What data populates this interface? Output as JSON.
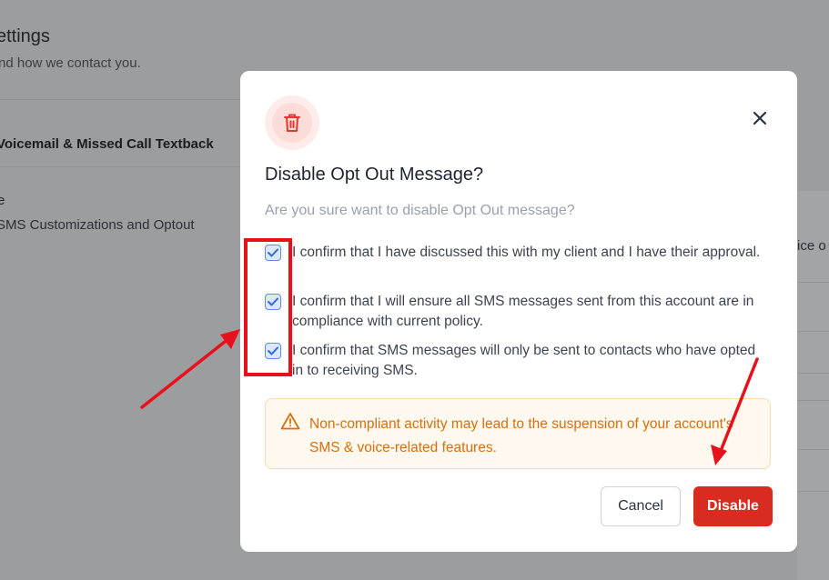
{
  "background": {
    "title": "ettings",
    "subtitle": "nd how we contact you.",
    "section_label": "Voicemail & Missed Call Textback",
    "item_title": "e",
    "item_subtitle": "SMS Customizations and Optout",
    "right_fragment": "ice o"
  },
  "modal": {
    "icon": "trash-icon",
    "title": "Disable Opt Out Message?",
    "description": "Are you sure want to disable Opt Out message?",
    "close_icon": "close-icon",
    "checkboxes": [
      {
        "checked": true,
        "label": "I confirm that I have discussed this with my client and I have their approval."
      },
      {
        "checked": true,
        "label": "I confirm that I will ensure all SMS messages sent from this account are in compliance with current policy."
      },
      {
        "checked": true,
        "label": "I confirm that SMS messages will only be sent to contacts who have opted in to receiving SMS."
      }
    ],
    "warning": {
      "icon": "warning-triangle-icon",
      "text": "Non-compliant activity may lead to the suspension of your account's SMS & voice-related features."
    },
    "buttons": {
      "cancel": "Cancel",
      "disable": "Disable"
    }
  },
  "colors": {
    "danger": "#d92c20",
    "warning_text": "#d66f0c",
    "warning_bg": "#fff8ee",
    "checkbox_accent": "#5b8ee8",
    "annotation_red": "#e8101a"
  }
}
